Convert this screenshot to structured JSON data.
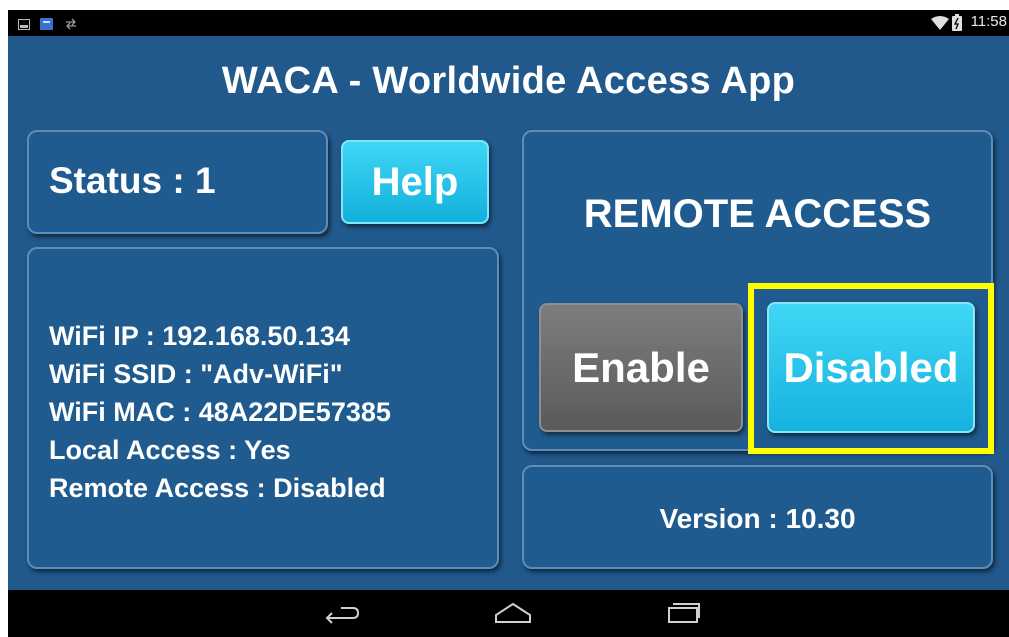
{
  "status_bar": {
    "left_icons": [
      "image-icon",
      "app-icon",
      "sync-icon"
    ],
    "right_icons": [
      "wifi-icon",
      "battery-icon"
    ],
    "time": "11:58"
  },
  "app": {
    "title": "WACA - Worldwide Access App"
  },
  "status_panel": {
    "label": "Status : 1"
  },
  "help_button": {
    "label": "Help"
  },
  "info_panel": {
    "lines": [
      "WiFi IP : 192.168.50.134",
      "WiFi SSID : \"Adv-WiFi\"",
      "WiFi MAC : 48A22DE57385",
      "Local Access : Yes",
      "Remote Access : Disabled"
    ]
  },
  "remote_access": {
    "title": "REMOTE ACCESS",
    "enable_label": "Enable",
    "disabled_label": "Disabled"
  },
  "version_panel": {
    "label": "Version : 10.30"
  },
  "nav_bar": {
    "icons": [
      "back-icon",
      "home-icon",
      "recents-icon"
    ]
  },
  "colors": {
    "background": "#21598c",
    "accent_button": "#1ab6e0",
    "enable_button": "#6b6b6b",
    "highlight": "#ffff00"
  }
}
